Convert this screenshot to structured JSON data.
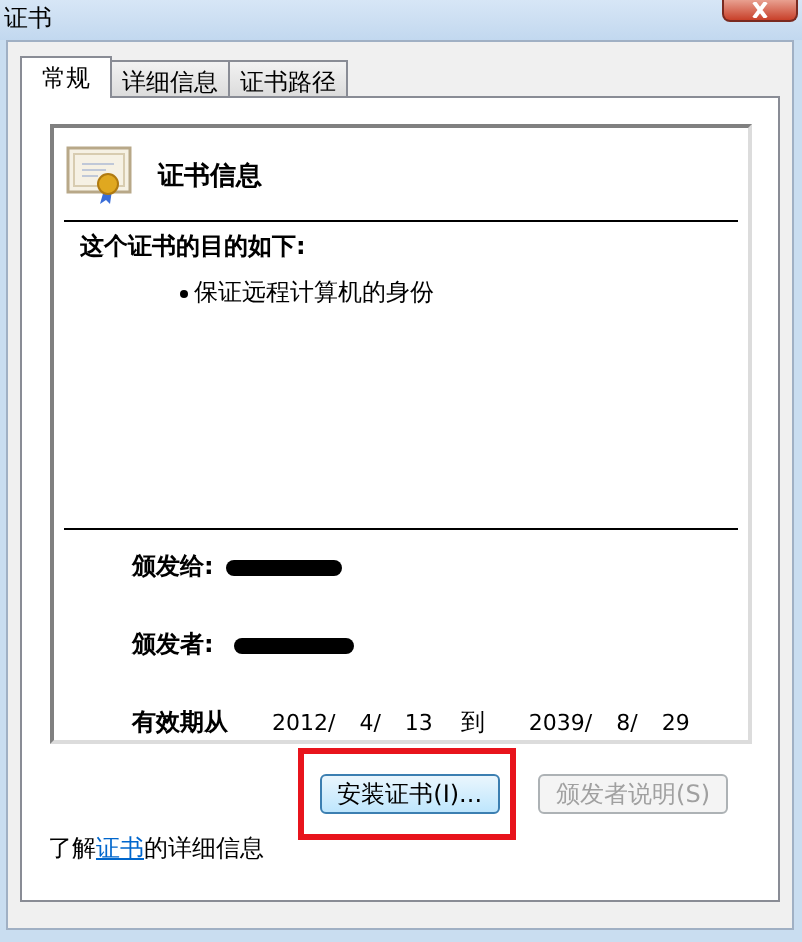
{
  "window": {
    "title": "证书"
  },
  "tabs": [
    {
      "label": "常规",
      "selected": true
    },
    {
      "label": "详细信息",
      "selected": false
    },
    {
      "label": "证书路径",
      "selected": false
    }
  ],
  "certificate": {
    "heading": "证书信息",
    "purpose_title": "这个证书的目的如下:",
    "purposes": [
      "保证远程计算机的身份"
    ],
    "issued_to_label": "颁发给:",
    "issued_to_redacted": true,
    "issued_by_label": "颁发者:",
    "issued_by_redacted": true,
    "validity_label": "有效期从",
    "valid_from": [
      "2012/",
      "4/",
      "13"
    ],
    "to_label": "到",
    "valid_to": [
      "2039/",
      "8/",
      "29"
    ]
  },
  "buttons": [
    {
      "label": "安装证书(I)...",
      "disabled": false,
      "highlighted": true
    },
    {
      "label": "颁发者说明(S)",
      "disabled": true,
      "highlighted": false
    }
  ],
  "info_link": {
    "before": "了解",
    "link": "证书",
    "after": "的详细信息"
  }
}
